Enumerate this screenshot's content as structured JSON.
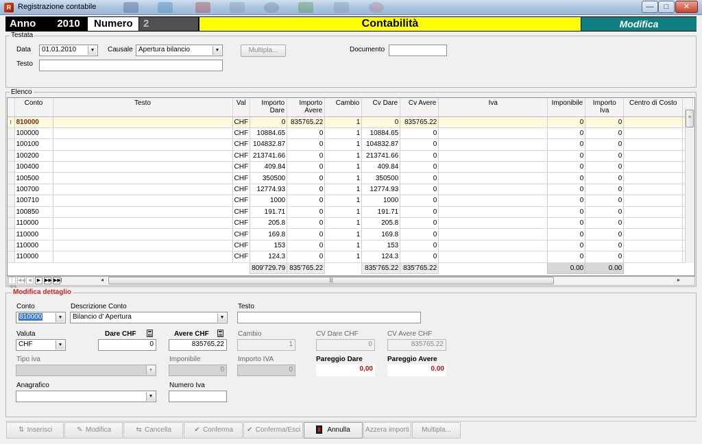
{
  "window": {
    "title": "Registrazione contabile",
    "minimize": "—",
    "maximize": "□",
    "close": "✕"
  },
  "header": {
    "anno_label": "Anno",
    "anno_value": "2010",
    "numero_label": "Numero",
    "numero_value": "2",
    "module": "Contabilità",
    "mode": "Modifica"
  },
  "testata": {
    "group_title": "Testata",
    "data_label": "Data",
    "data_value": "01.01.2010",
    "causale_label": "Causale",
    "causale_value": "Apertura bilancio",
    "multipla_button": "Multipla...",
    "documento_label": "Documento",
    "documento_value": "",
    "testo_label": "Testo",
    "testo_value": ""
  },
  "elenco": {
    "group_title": "Elenco",
    "columns": {
      "conto": "Conto",
      "testo": "Testo",
      "val": "Val",
      "importo_dare": "Importo Dare",
      "importo_avere": "Importo Avere",
      "cambio": "Cambio",
      "cv_dare": "Cv Dare",
      "cv_avere": "Cv Avere",
      "iva": "Iva",
      "imponibile": "Imponibile",
      "importo_iva": "Importo Iva",
      "centro_costo": "Centro di Costo"
    },
    "row_indicator": "I",
    "rows": [
      {
        "conto": "810000",
        "testo": "",
        "val": "CHF",
        "dare": "0",
        "avere": "835765.22",
        "cambio": "1",
        "cv_dare": "0",
        "cv_avere": "835765.22",
        "iva": "",
        "imponibile": "0",
        "importo_iva": "0",
        "centro": ""
      },
      {
        "conto": "100000",
        "testo": "",
        "val": "CHF",
        "dare": "10884.65",
        "avere": "0",
        "cambio": "1",
        "cv_dare": "10884.65",
        "cv_avere": "0",
        "iva": "",
        "imponibile": "0",
        "importo_iva": "0",
        "centro": ""
      },
      {
        "conto": "100100",
        "testo": "",
        "val": "CHF",
        "dare": "104832.87",
        "avere": "0",
        "cambio": "1",
        "cv_dare": "104832.87",
        "cv_avere": "0",
        "iva": "",
        "imponibile": "0",
        "importo_iva": "0",
        "centro": ""
      },
      {
        "conto": "100200",
        "testo": "",
        "val": "CHF",
        "dare": "213741.66",
        "avere": "0",
        "cambio": "1",
        "cv_dare": "213741.66",
        "cv_avere": "0",
        "iva": "",
        "imponibile": "0",
        "importo_iva": "0",
        "centro": ""
      },
      {
        "conto": "100400",
        "testo": "",
        "val": "CHF",
        "dare": "409.84",
        "avere": "0",
        "cambio": "1",
        "cv_dare": "409.84",
        "cv_avere": "0",
        "iva": "",
        "imponibile": "0",
        "importo_iva": "0",
        "centro": ""
      },
      {
        "conto": "100500",
        "testo": "",
        "val": "CHF",
        "dare": "350500",
        "avere": "0",
        "cambio": "1",
        "cv_dare": "350500",
        "cv_avere": "0",
        "iva": "",
        "imponibile": "0",
        "importo_iva": "0",
        "centro": ""
      },
      {
        "conto": "100700",
        "testo": "",
        "val": "CHF",
        "dare": "12774.93",
        "avere": "0",
        "cambio": "1",
        "cv_dare": "12774.93",
        "cv_avere": "0",
        "iva": "",
        "imponibile": "0",
        "importo_iva": "0",
        "centro": ""
      },
      {
        "conto": "100710",
        "testo": "",
        "val": "CHF",
        "dare": "1000",
        "avere": "0",
        "cambio": "1",
        "cv_dare": "1000",
        "cv_avere": "0",
        "iva": "",
        "imponibile": "0",
        "importo_iva": "0",
        "centro": ""
      },
      {
        "conto": "100850",
        "testo": "",
        "val": "CHF",
        "dare": "191.71",
        "avere": "0",
        "cambio": "1",
        "cv_dare": "191.71",
        "cv_avere": "0",
        "iva": "",
        "imponibile": "0",
        "importo_iva": "0",
        "centro": ""
      },
      {
        "conto": "110000",
        "testo": "",
        "val": "CHF",
        "dare": "205.8",
        "avere": "0",
        "cambio": "1",
        "cv_dare": "205.8",
        "cv_avere": "0",
        "iva": "",
        "imponibile": "0",
        "importo_iva": "0",
        "centro": ""
      },
      {
        "conto": "110000",
        "testo": "",
        "val": "CHF",
        "dare": "169.8",
        "avere": "0",
        "cambio": "1",
        "cv_dare": "169.8",
        "cv_avere": "0",
        "iva": "",
        "imponibile": "0",
        "importo_iva": "0",
        "centro": ""
      },
      {
        "conto": "110000",
        "testo": "",
        "val": "CHF",
        "dare": "153",
        "avere": "0",
        "cambio": "1",
        "cv_dare": "153",
        "cv_avere": "0",
        "iva": "",
        "imponibile": "0",
        "importo_iva": "0",
        "centro": ""
      },
      {
        "conto": "110000",
        "testo": "",
        "val": "CHF",
        "dare": "124.3",
        "avere": "0",
        "cambio": "1",
        "cv_dare": "124.3",
        "cv_avere": "0",
        "iva": "",
        "imponibile": "0",
        "importo_iva": "0",
        "centro": ""
      }
    ],
    "totals": {
      "dare": "809'729.79",
      "avere": "835'765.22",
      "cv_dare": "835'765.22",
      "cv_avere": "835'765.22",
      "imponibile": "0.00",
      "importo_iva": "0.00"
    },
    "nav": {
      "first": "|◀◀",
      "prev_page": "◀◀",
      "prev": "◀",
      "next": "▶",
      "next_page": "▶▶",
      "last": "▶▶|",
      "scroll_left": "◂",
      "scroll_right": "▸",
      "grip": "|||"
    }
  },
  "dettaglio": {
    "title": "Modifica dettaglio",
    "conto_label": "Conto",
    "conto_value": "810000",
    "descrizione_label": "Descrizione Conto",
    "descrizione_value": "Bilancio d' Apertura",
    "testo_label": "Testo",
    "testo_value": "",
    "valuta_label": "Valuta",
    "valuta_value": "CHF",
    "dare_label": "Dare CHF",
    "dare_value": "0",
    "avere_label": "Avere CHF",
    "avere_value": "835765.22",
    "cambio_label": "Cambio",
    "cambio_value": "1",
    "cv_dare_label": "CV Dare CHF",
    "cv_dare_value": "0",
    "cv_avere_label": "CV Avere CHF",
    "cv_avere_value": "835765.22",
    "tipo_iva_label": "Tipo iva",
    "tipo_iva_value": "",
    "imponibile_label": "Imponibile",
    "imponibile_value": "0",
    "importo_iva_label": "Importo IVA",
    "importo_iva_value": "0",
    "pareggio_dare_label": "Pareggio Dare",
    "pareggio_dare_value": "0,00",
    "pareggio_avere_label": "Pareggio Avere",
    "pareggio_avere_value": "0.00",
    "anagrafico_label": "Anagrafico",
    "anagrafico_value": "",
    "numero_iva_label": "Numero Iva",
    "numero_iva_value": ""
  },
  "toolbar": {
    "inserisci": "Inserisci",
    "modifica": "Modifica",
    "cancella": "Cancella",
    "conferma": "Conferma",
    "conferma_esci": "Conferma/Esci",
    "annulla": "Annulla",
    "azzera": "Azzera importi",
    "multipla": "Multipla..."
  },
  "colors": {
    "accent_yellow": "#ffff00",
    "mode_teal": "#0e7e7e",
    "detail_red": "#d22020",
    "pareggio_red": "#b01010"
  }
}
